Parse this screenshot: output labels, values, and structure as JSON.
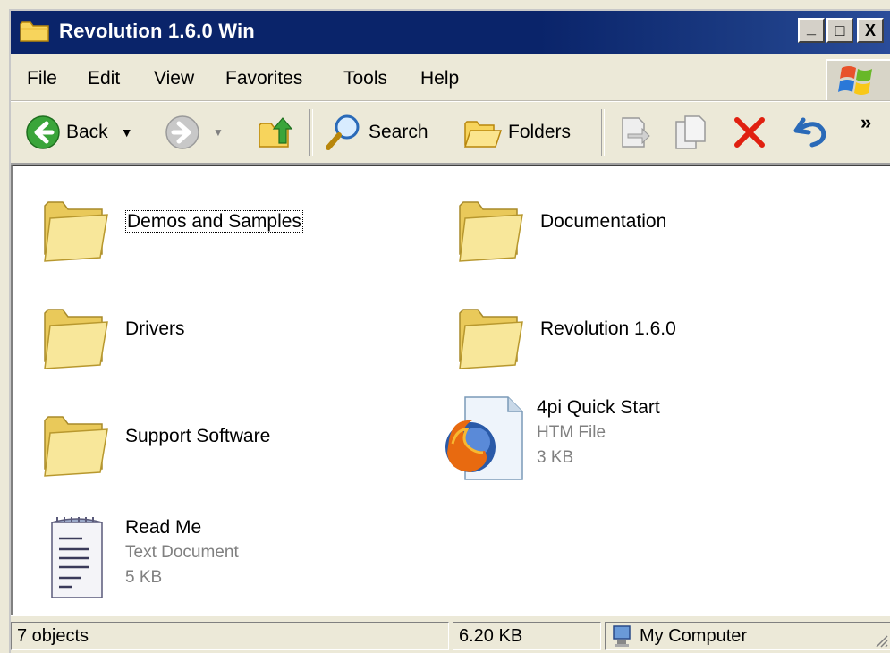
{
  "window": {
    "title": "Revolution 1.6.0 Win"
  },
  "titlebar_buttons": {
    "minimize": "_",
    "maximize": "□",
    "close": "X"
  },
  "menu": {
    "items": [
      "File",
      "Edit",
      "View",
      "Favorites",
      "Tools",
      "Help"
    ]
  },
  "toolbar": {
    "back_label": "Back",
    "search_label": "Search",
    "folders_label": "Folders",
    "more_label": "»"
  },
  "files": [
    {
      "name": "Demos and Samples",
      "type": "folder",
      "selected": true
    },
    {
      "name": "Documentation",
      "type": "folder"
    },
    {
      "name": "Drivers",
      "type": "folder"
    },
    {
      "name": "Revolution 1.6.0",
      "type": "folder"
    },
    {
      "name": "Support Software",
      "type": "folder"
    },
    {
      "name": "4pi Quick Start",
      "type": "htm",
      "kind": "HTM File",
      "size": "3 KB"
    },
    {
      "name": "Read Me",
      "type": "text",
      "kind": "Text Document",
      "size": "5 KB"
    }
  ],
  "status": {
    "objects": "7 objects",
    "size": "6.20 KB",
    "zone": "My Computer"
  },
  "colors": {
    "titlebar": "#0a246a",
    "folder": "#f5e08a",
    "delete_red": "#e02010",
    "back_green": "#3aa53a"
  }
}
